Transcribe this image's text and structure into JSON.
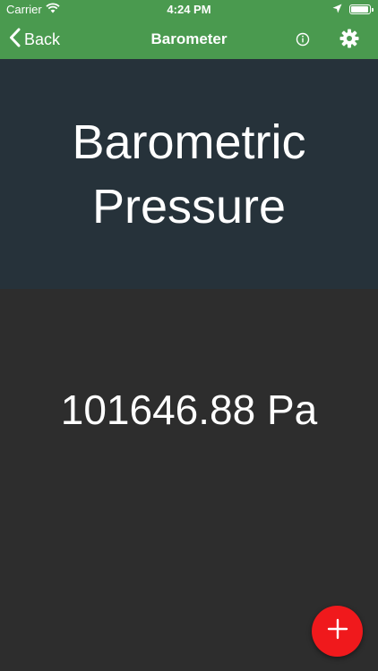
{
  "status_bar": {
    "carrier": "Carrier",
    "time": "4:24 PM"
  },
  "nav": {
    "back_label": "Back",
    "title": "Barometer"
  },
  "header": {
    "title": "Barometric Pressure"
  },
  "reading": {
    "value": "101646.88 Pa"
  },
  "icons": {
    "wifi": "wifi-icon",
    "location": "location-arrow-icon",
    "battery": "battery-icon",
    "back": "chevron-left-icon",
    "info": "info-icon",
    "settings": "gear-icon",
    "add": "plus-icon"
  },
  "colors": {
    "nav_green": "#4a9a4f",
    "header_bg": "#26323a",
    "body_bg": "#2d2d2d",
    "fab_red": "#f0191c"
  }
}
